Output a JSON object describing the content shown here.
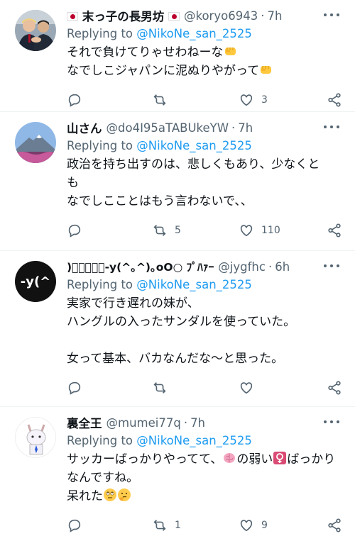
{
  "tweets": [
    {
      "name_prefix_flag": "jp-flag-icon",
      "name": "末っ子の長男坊",
      "handle": "@koryo6943",
      "separator": "·",
      "time": "7h",
      "replying_label": "Replying to ",
      "replying_to": "@NikoNe_san_2525",
      "lines": [
        "それで負けてりゃせわねーな",
        "なでしこジャパンに泥ぬりやがって"
      ],
      "reply_count": "",
      "retweet_count": "",
      "like_count": "3",
      "avatar_icon": "photo-avatar-icon"
    },
    {
      "name": "山さん",
      "handle": "@do4I95aTABUkeYW",
      "separator": "·",
      "time": "7h",
      "replying_label": "Replying to ",
      "replying_to": "@NikoNe_san_2525",
      "lines": [
        "政治を持ち出すのは、悲しくもあり、少なくと",
        "も",
        "なでしこことはもう言わないで、、"
      ],
      "reply_count": "",
      "retweet_count": "5",
      "like_count": "110",
      "avatar_icon": "mountain-avatar-icon"
    },
    {
      "name": ")ﾟﾟﾟﾟﾟ-y(^｡^)｡oO○ ﾌﾟﾊｧｰ",
      "handle": "@jygfhc",
      "separator": "·",
      "time": "6h",
      "replying_label": "Replying to ",
      "replying_to": "@NikoNe_san_2525",
      "lines": [
        "実家で行き遅れの妹が、",
        "ハングルの入ったサンダルを使っていた。",
        "",
        "女って基本、バカなんだな〜と思った。"
      ],
      "reply_count": "",
      "retweet_count": "",
      "like_count": "",
      "avatar_text": "-y(^"
    },
    {
      "name": "裏全王",
      "handle": "@mumei77q",
      "separator": "·",
      "time": "7h",
      "replying_label": "Replying to ",
      "replying_to": "@NikoNe_san_2525",
      "line1_a": "サッカーばっかりやってて、",
      "line1_b": "の弱い",
      "line1_c": "ばっかり",
      "line2": "なんですね。",
      "line3": "呆れた",
      "reply_count": "",
      "retweet_count": "1",
      "like_count": "9",
      "avatar_icon": "cartoon-character-avatar-icon"
    }
  ],
  "colors": {
    "accent": "#1d9bf0",
    "muted": "#536471",
    "text": "#0f1419",
    "divider": "#eff3f4"
  }
}
